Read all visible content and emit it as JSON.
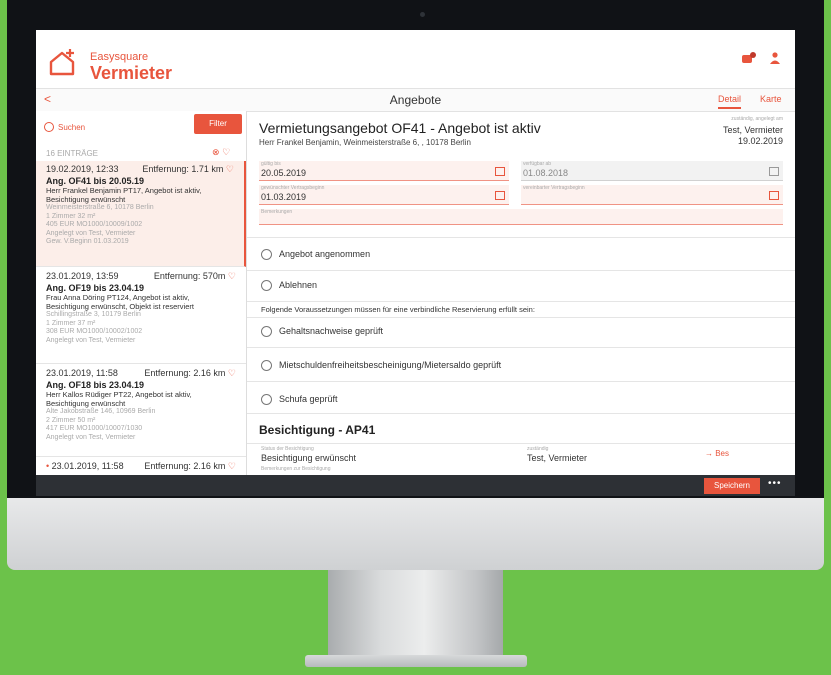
{
  "brand": {
    "small": "Easysquare",
    "big": "Vermieter"
  },
  "header": {
    "badge_count": "1"
  },
  "nav": {
    "back": "<",
    "title": "Angebote",
    "tabs": [
      "Detail",
      "Karte"
    ]
  },
  "list": {
    "search_label": "Suchen",
    "filter_label": "Filter",
    "count": "16 EINTRÄGE",
    "entries": [
      {
        "date": "19.02.2019, 12:33",
        "distance": "Entfernung: 1.71 km",
        "title": "Ang. OF41 bis 20.05.19",
        "desc1": "Herr Frankel Benjamin PT17, Angebot ist aktiv,",
        "desc2": "Besichtigung erwünscht",
        "addr": "Weinmeisterstraße 6, 10178 Berlin",
        "rooms": "1 Zimmer      32 m²",
        "price": "405 EUR        MO1000/10009/1002",
        "created": "Angelegt von   Test, Vermieter",
        "start": "Gew. V.Beginn  01.03.2019"
      },
      {
        "date": "23.01.2019, 13:59",
        "distance": "Entfernung: 570m",
        "title": "Ang. OF19 bis 23.04.19",
        "desc1": "Frau Anna Döring PT124, Angebot ist aktiv,",
        "desc2": "Besichtigung erwünscht, Objekt ist reserviert",
        "addr": "Schillingstraße 3, 10179 Berlin",
        "rooms": "1 Zimmer      37 m²",
        "price": "308 EUR        MO1000/10002/1002",
        "created": "Angelegt von   Test, Vermieter"
      },
      {
        "date": "23.01.2019, 11:58",
        "distance": "Entfernung: 2.16 km",
        "title": "Ang. OF18 bis 23.04.19",
        "desc1": "Herr Kallos Rüdiger PT22, Angebot ist aktiv,",
        "desc2": "Besichtigung erwünscht",
        "addr": "Alte Jakobstraße 146, 10969 Berlin",
        "rooms": "2 Zimmer      50 m²",
        "price": "417 EUR        MO1000/10007/1030",
        "created": "Angelegt von   Test, Vermieter"
      },
      {
        "date": "23.01.2019, 11:58",
        "distance": "Entfernung: 2.16 km"
      }
    ]
  },
  "detail": {
    "title": "Vermietungsangebot OF41 - Angebot ist aktiv",
    "subtitle": "Herr Frankel Benjamin, Weinmeisterstraße 6, , 10178 Berlin",
    "resp_label": "zuständig, angelegt am",
    "resp_name": "Test, Vermieter",
    "resp_date": "19.02.2019",
    "fields": {
      "valid_label": "gültig bis",
      "valid_value": "20.05.2019",
      "avail_label": "verfügbar ab",
      "avail_value": "01.08.2018",
      "desired_label": "gewünschter Vertragsbeginn",
      "desired_value": "01.03.2019",
      "agreed_label": "vereinbarter Vertragsbeginn",
      "agreed_value": "",
      "notes_label": "Bemerkungen"
    },
    "options": [
      "Angebot angenommen",
      "Ablehnen"
    ],
    "info": "Folgende Voraussetzungen müssen für eine verbindliche Reservierung erfüllt sein:",
    "requirements": [
      "Gehaltsnachweise geprüft",
      "Mietschuldenfreiheitsbescheinigung/Mietersaldo geprüft",
      "Schufa geprüft"
    ],
    "viewing": {
      "title": "Besichtigung - AP41",
      "status_label": "Status der Besichtigung",
      "status_value": "Besichtigung erwünscht",
      "resp_label": "zuständig",
      "resp_value": "Test, Vermieter",
      "link": "→  Bes",
      "notes_label": "Bemerkungen zur Besichtigung"
    }
  },
  "footer": {
    "save": "Speichern",
    "more": "•••"
  }
}
